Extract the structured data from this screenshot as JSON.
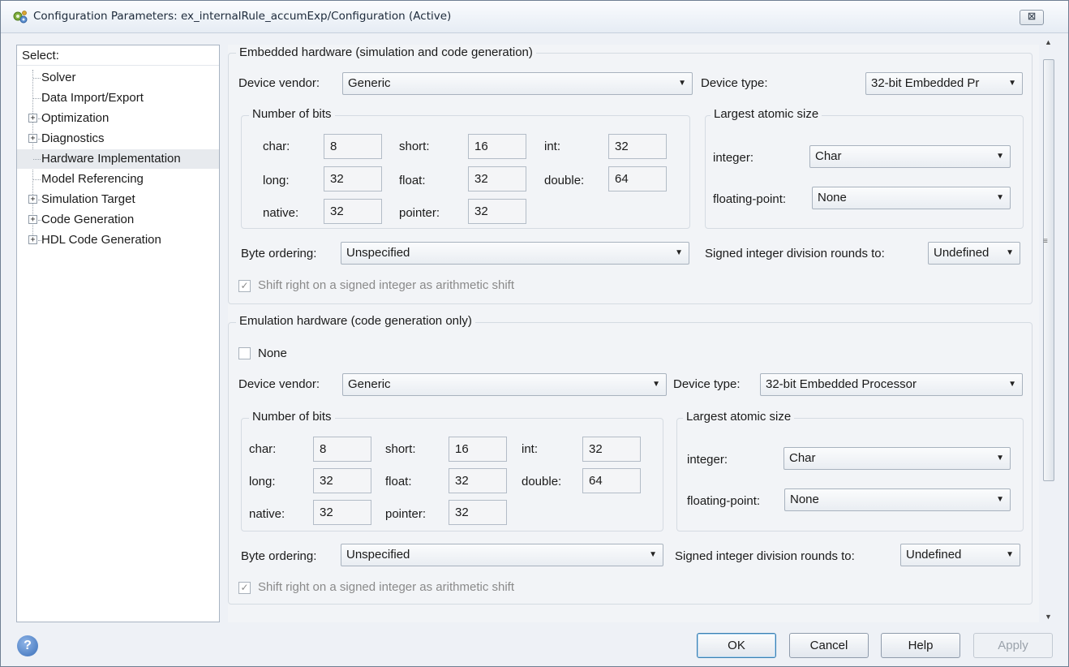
{
  "window": {
    "title": "Configuration Parameters: ex_internalRule_accumExp/Configuration (Active)",
    "close_glyph": "☒"
  },
  "tree": {
    "header": "Select:",
    "items": [
      {
        "label": "Solver",
        "expandable": false
      },
      {
        "label": "Data Import/Export",
        "expandable": false
      },
      {
        "label": "Optimization",
        "expandable": true
      },
      {
        "label": "Diagnostics",
        "expandable": true
      },
      {
        "label": "Hardware Implementation",
        "expandable": false,
        "selected": true
      },
      {
        "label": "Model Referencing",
        "expandable": false
      },
      {
        "label": "Simulation Target",
        "expandable": true
      },
      {
        "label": "Code Generation",
        "expandable": true
      },
      {
        "label": "HDL Code Generation",
        "expandable": true
      }
    ]
  },
  "embedded": {
    "title": "Embedded hardware (simulation and code generation)",
    "vendor_label": "Device vendor:",
    "vendor_value": "Generic",
    "type_label": "Device type:",
    "type_value": "32-bit Embedded Pr⁠",
    "bits_title": "Number of bits",
    "bits": {
      "char_label": "char:",
      "char": "8",
      "short_label": "short:",
      "short": "16",
      "int_label": "int:",
      "int": "32",
      "long_label": "long:",
      "long": "32",
      "float_label": "float:",
      "float": "32",
      "double_label": "double:",
      "double": "64",
      "native_label": "native:",
      "native": "32",
      "pointer_label": "pointer:",
      "pointer": "32"
    },
    "atomic_title": "Largest atomic size",
    "integer_label": "integer:",
    "integer_value": "Char",
    "fp_label": "floating-point:",
    "fp_value": "None",
    "byte_label": "Byte ordering:",
    "byte_value": "Unspecified",
    "sdiv_label": "Signed integer division rounds to:",
    "sdiv_value": "Undefined",
    "shift_label": "Shift right on a signed integer as arithmetic shift",
    "shift_checked": true
  },
  "emulation": {
    "title": "Emulation hardware (code generation only)",
    "none_label": "None",
    "none_checked": false,
    "vendor_label": "Device vendor:",
    "vendor_value": "Generic",
    "type_label": "Device type:",
    "type_value": "32-bit Embedded Processor",
    "bits_title": "Number of bits",
    "bits": {
      "char_label": "char:",
      "char": "8",
      "short_label": "short:",
      "short": "16",
      "int_label": "int:",
      "int": "32",
      "long_label": "long:",
      "long": "32",
      "float_label": "float:",
      "float": "32",
      "double_label": "double:",
      "double": "64",
      "native_label": "native:",
      "native": "32",
      "pointer_label": "pointer:",
      "pointer": "32"
    },
    "atomic_title": "Largest atomic size",
    "integer_label": "integer:",
    "integer_value": "Char",
    "fp_label": "floating-point:",
    "fp_value": "None",
    "byte_label": "Byte ordering:",
    "byte_value": "Unspecified",
    "sdiv_label": "Signed integer division rounds to:",
    "sdiv_value": "Undefined",
    "shift_label": "Shift right on a signed integer as arithmetic shift",
    "shift_checked": true
  },
  "buttons": {
    "ok": "OK",
    "cancel": "Cancel",
    "help": "Help",
    "apply": "Apply",
    "help_icon_glyph": "?"
  },
  "icons": {
    "app": "gears-icon",
    "arrow": "▼",
    "check": "✓",
    "scroll_up": "▲",
    "scroll_down": "▼",
    "grip": "≡"
  },
  "colors": {
    "window_bg": "#eef1f6",
    "panel_bg": "#f2f4f7",
    "selection": "#e7eaee",
    "ok_border": "#3c7fb1"
  }
}
